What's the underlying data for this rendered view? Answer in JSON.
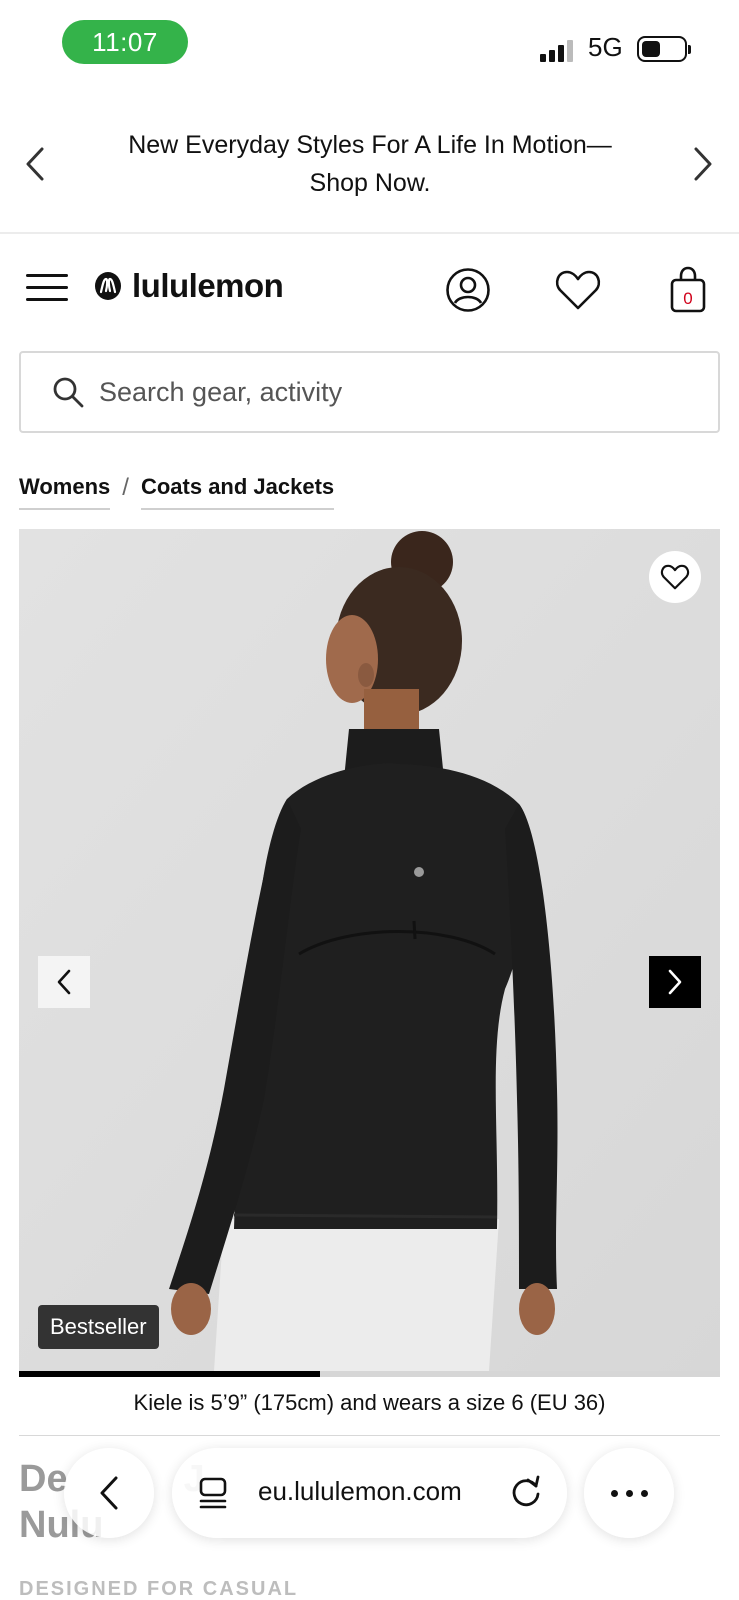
{
  "status_bar": {
    "time": "11:07",
    "network": "5G",
    "time_pill_color": "#34b34a"
  },
  "promo": {
    "text": "New Everyday Styles For A Life In Motion—Shop Now.",
    "prev_icon": "chevron-left-icon",
    "next_icon": "chevron-right-icon"
  },
  "nav": {
    "brand": "lululemon",
    "cart_count": "0",
    "cart_count_color": "#d0021b",
    "icons": [
      "menu-icon",
      "lululemon-logo-icon",
      "account-icon",
      "heart-icon",
      "shopping-bag-icon"
    ]
  },
  "search": {
    "placeholder": "Search gear, activity",
    "value": ""
  },
  "breadcrumb": {
    "items": [
      "Womens",
      "Coats and Jackets"
    ],
    "separator": "/"
  },
  "product": {
    "badge": "Bestseller",
    "image_progress": 0.43,
    "model_note": "Kiele is 5’9” (175cm) and wears a size 6 (EU 36)",
    "title_partial_line1": "De",
    "title_partial_line1_b": "J",
    "title_partial_line2": "Nulu",
    "subtitle_partial": "DESIGNED FOR CASUAL"
  },
  "browser": {
    "url": "eu.lululemon.com"
  }
}
